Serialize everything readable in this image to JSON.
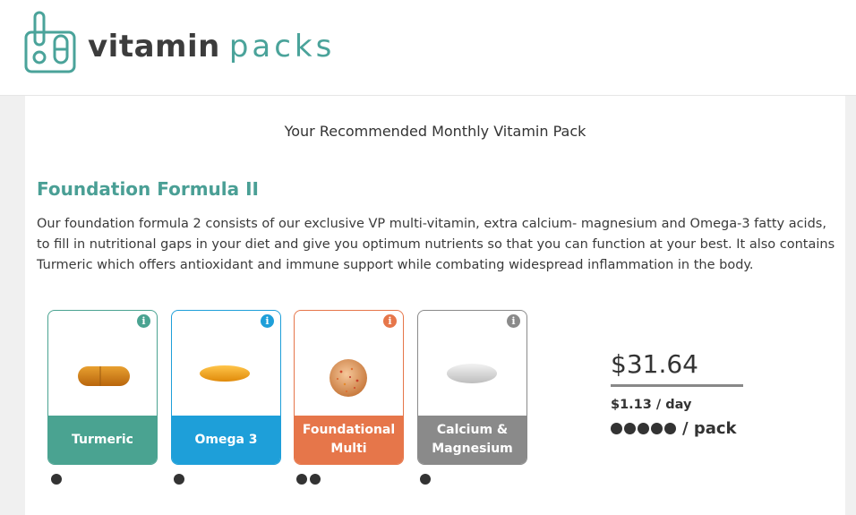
{
  "brand": {
    "name_part1": "vitamin",
    "name_part2": "packs",
    "accent": "#4aa39a"
  },
  "page": {
    "heading": "Your Recommended Monthly Vitamin Pack"
  },
  "formula": {
    "title": "Foundation Formula II",
    "description": "Our foundation formula 2 consists of our exclusive VP multi-vitamin, extra calcium- magnesium and Omega-3 fatty acids, to fill in nutritional gaps in your diet and give you optimum nutrients so that you can function at your best. It also contains Turmeric which offers antioxidant and immune support while combating widespread inflammation in the body."
  },
  "products": [
    {
      "name": "Turmeric",
      "color": "#4aa391",
      "icon": "info-icon",
      "dots": 1
    },
    {
      "name": "Omega 3",
      "color": "#1e9fd9",
      "icon": "info-icon",
      "dots": 1
    },
    {
      "name": "Foundational Multi",
      "color": "#e6764a",
      "icon": "info-icon",
      "dots": 2
    },
    {
      "name": "Calcium & Magnesium",
      "color": "#8a8a8a",
      "icon": "info-icon",
      "dots": 1
    }
  ],
  "pricing": {
    "price": "$31.64",
    "per_day": "$1.13 / day",
    "per_pack_dots": 5,
    "per_pack_label": "/ pack"
  }
}
